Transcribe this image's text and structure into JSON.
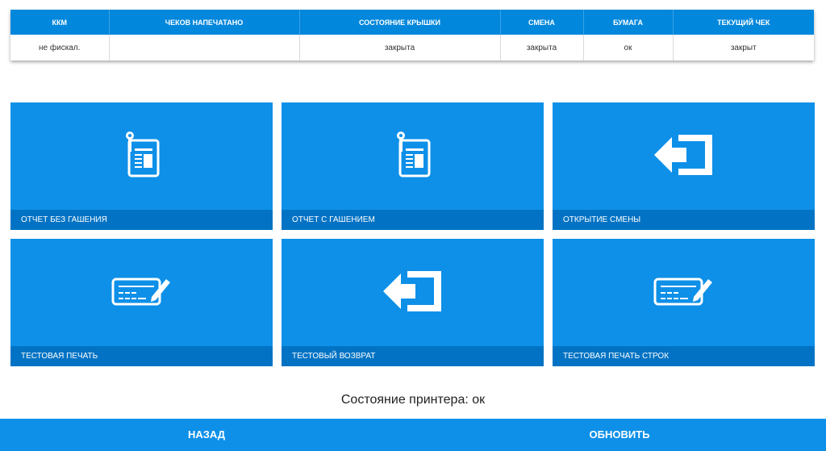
{
  "table": {
    "headers": [
      "ККМ",
      "ЧЕКОВ НАПЕЧАТАНО",
      "СОСТОЯНИЕ КРЫШКИ",
      "СМЕНА",
      "БУМАГА",
      "ТЕКУЩИЙ ЧЕК"
    ],
    "row": [
      "не фискал.",
      "",
      "закрыта",
      "закрыта",
      "ок",
      "закрыт"
    ]
  },
  "tiles": [
    {
      "label": "ОТЧЕТ БЕЗ ГАШЕНИЯ",
      "icon": "report-icon"
    },
    {
      "label": "ОТЧЕТ С ГАШЕНИЕМ",
      "icon": "report-icon"
    },
    {
      "label": "ОТКРЫТИЕ СМЕНЫ",
      "icon": "enter-arrow-icon"
    },
    {
      "label": "ТЕСТОВАЯ ПЕЧАТЬ",
      "icon": "receipt-pen-icon"
    },
    {
      "label": "ТЕСТОВЫЙ ВОЗВРАТ",
      "icon": "enter-arrow-icon"
    },
    {
      "label": "ТЕСТОВАЯ ПЕЧАТЬ СТРОК",
      "icon": "receipt-pen-icon"
    }
  ],
  "printer_status": "Состояние принтера: ок",
  "bottom": {
    "back_label": "НАЗАД",
    "refresh_label": "ОБНОВИТЬ"
  },
  "colors": {
    "accent": "#0e90e8",
    "header": "#0187dc",
    "tile_label_bg": "#0273c4"
  }
}
